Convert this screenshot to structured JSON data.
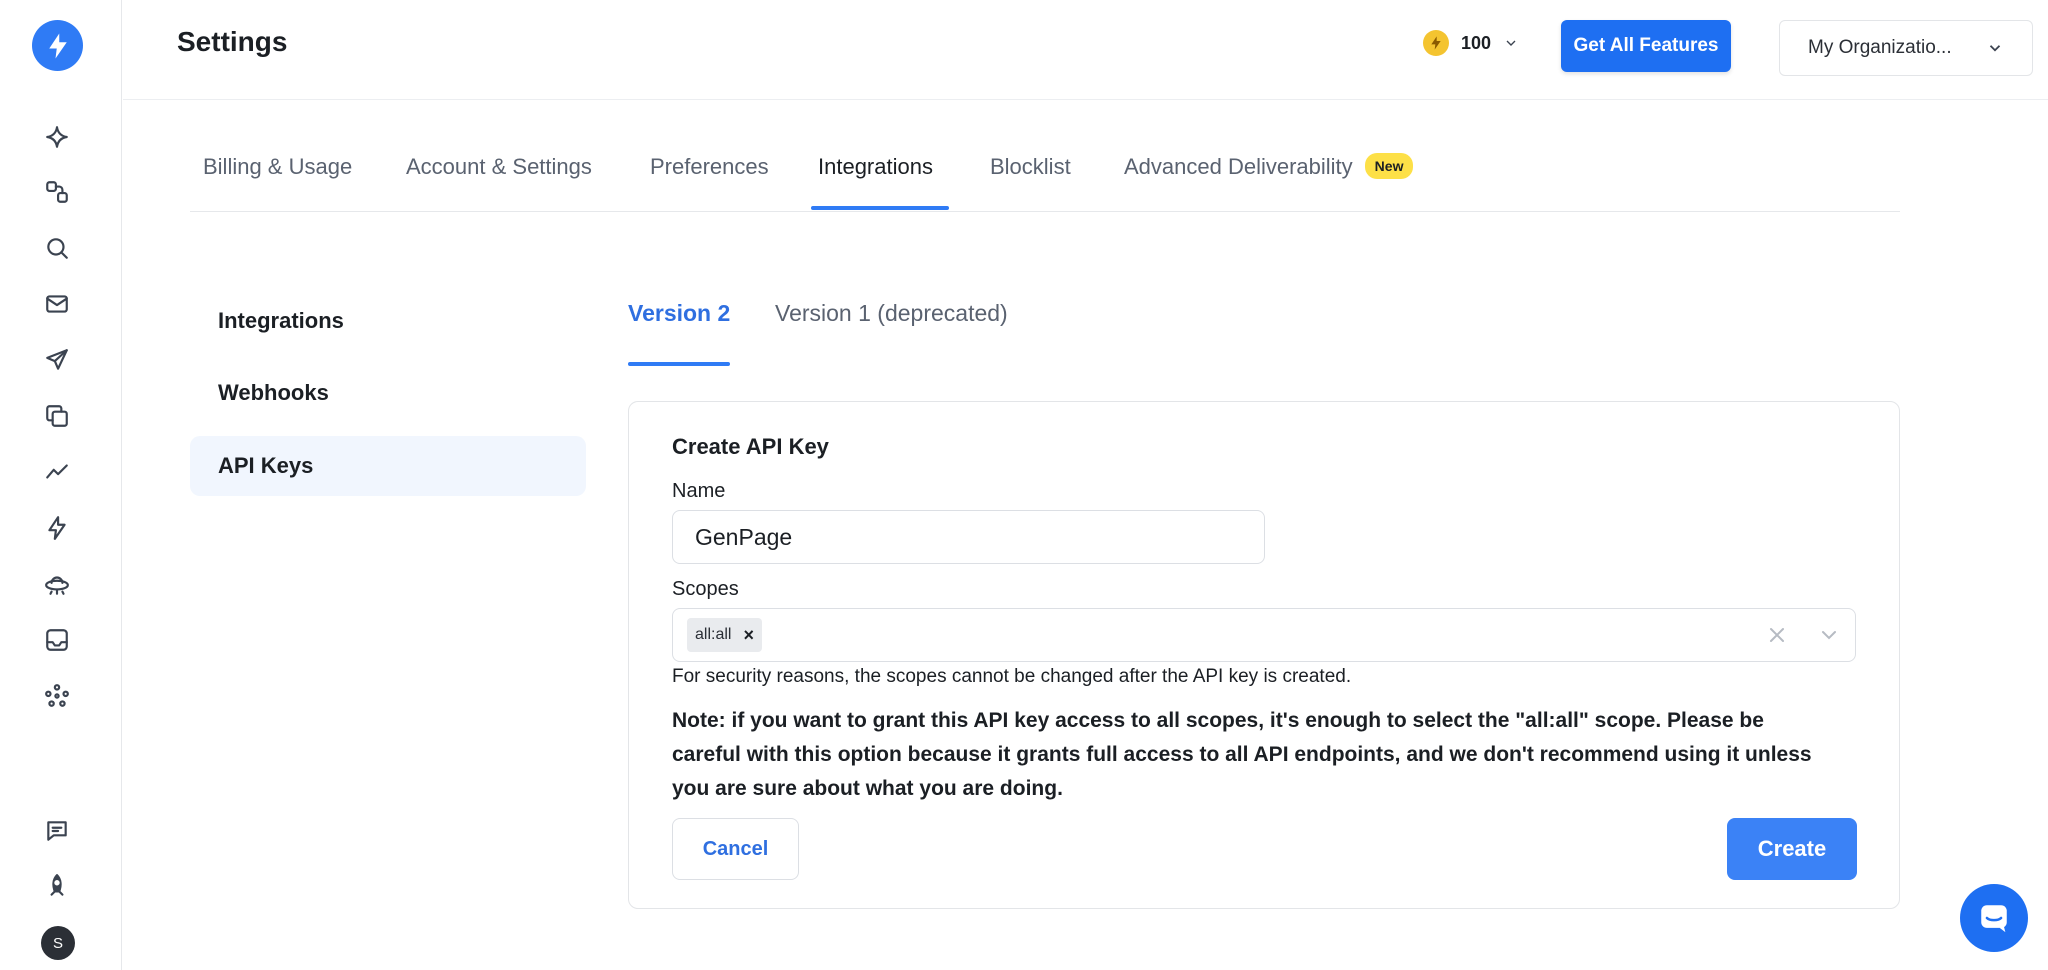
{
  "header": {
    "title": "Settings",
    "credits_value": "100",
    "get_features_label": "Get All Features",
    "organization_label": "My Organizatio..."
  },
  "tabs": [
    {
      "label": "Billing & Usage"
    },
    {
      "label": "Account & Settings"
    },
    {
      "label": "Preferences"
    },
    {
      "label": "Integrations"
    },
    {
      "label": "Blocklist"
    },
    {
      "label": "Advanced Deliverability",
      "badge": "New"
    }
  ],
  "sidenav": [
    {
      "label": "Integrations"
    },
    {
      "label": "Webhooks"
    },
    {
      "label": "API Keys"
    }
  ],
  "version_tabs": [
    {
      "label": "Version 2"
    },
    {
      "label": "Version 1 (deprecated)"
    }
  ],
  "form": {
    "title": "Create API Key",
    "name_label": "Name",
    "name_value": "GenPage",
    "scopes_label": "Scopes",
    "scope_chip": "all:all",
    "helper": "For security reasons, the scopes cannot be changed after the API key is created.",
    "note": "Note: if you want to grant this API key access to all scopes, it's enough to select the \"all:all\" scope. Please be careful with this option because it grants full access to all API endpoints, and we don't recommend using it unless you are sure about what you are doing.",
    "cancel_label": "Cancel",
    "create_label": "Create"
  },
  "user": {
    "avatar_initial": "S"
  },
  "colors": {
    "accent": "#2f7bf5",
    "primary_button": "#1e6ff2",
    "badge": "#fde047"
  }
}
